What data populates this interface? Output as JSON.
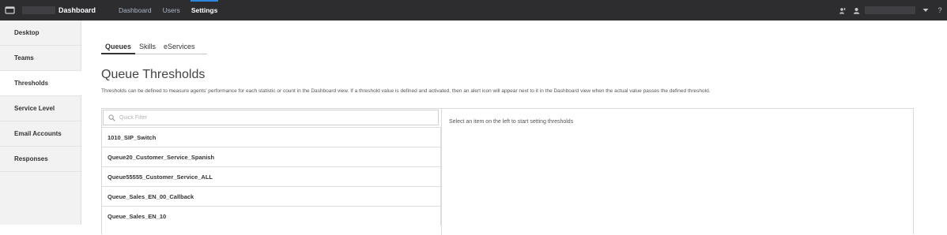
{
  "topbar": {
    "brand": "Dashboard",
    "nav": [
      {
        "label": "Dashboard",
        "active": false
      },
      {
        "label": "Users",
        "active": false
      },
      {
        "label": "Settings",
        "active": true
      }
    ],
    "icons": {
      "app": "app-window-icon",
      "alert": "alert-person-icon",
      "user": "user-icon",
      "caret": "caret-down-icon",
      "help": "help-icon"
    },
    "help_label": "?"
  },
  "sidebar": {
    "items": [
      {
        "label": "Desktop",
        "active": false
      },
      {
        "label": "Teams",
        "active": false
      },
      {
        "label": "Thresholds",
        "active": true
      },
      {
        "label": "Service Level",
        "active": false
      },
      {
        "label": "Email Accounts",
        "active": false
      },
      {
        "label": "Responses",
        "active": false
      }
    ]
  },
  "main": {
    "tabs": [
      {
        "label": "Queues",
        "active": true
      },
      {
        "label": "Skills",
        "active": false
      },
      {
        "label": "eServices",
        "active": false
      }
    ],
    "title": "Queue Thresholds",
    "description": "Thresholds can be defined to measure agents' performance for each statistic or count in the Dashboard view. If a threshold value is defined and activated, then an alert icon will appear next to it in the Dashboard view when the actual value passes the defined threshold.",
    "search": {
      "placeholder": "Quick Filter",
      "value": ""
    },
    "queues": [
      "1010_SIP_Switch",
      "Queue20_Customer_Service_Spanish",
      "Queue55555_Customer_Service_ALL",
      "Queue_Sales_EN_00_Callback",
      "Queue_Sales_EN_10"
    ],
    "detail_hint": "Select an item on the left to start setting thresholds"
  },
  "colors": {
    "topbar_bg": "#2d2d30",
    "active_accent": "#2e86de",
    "sidebar_bg": "#f2f2f2"
  }
}
